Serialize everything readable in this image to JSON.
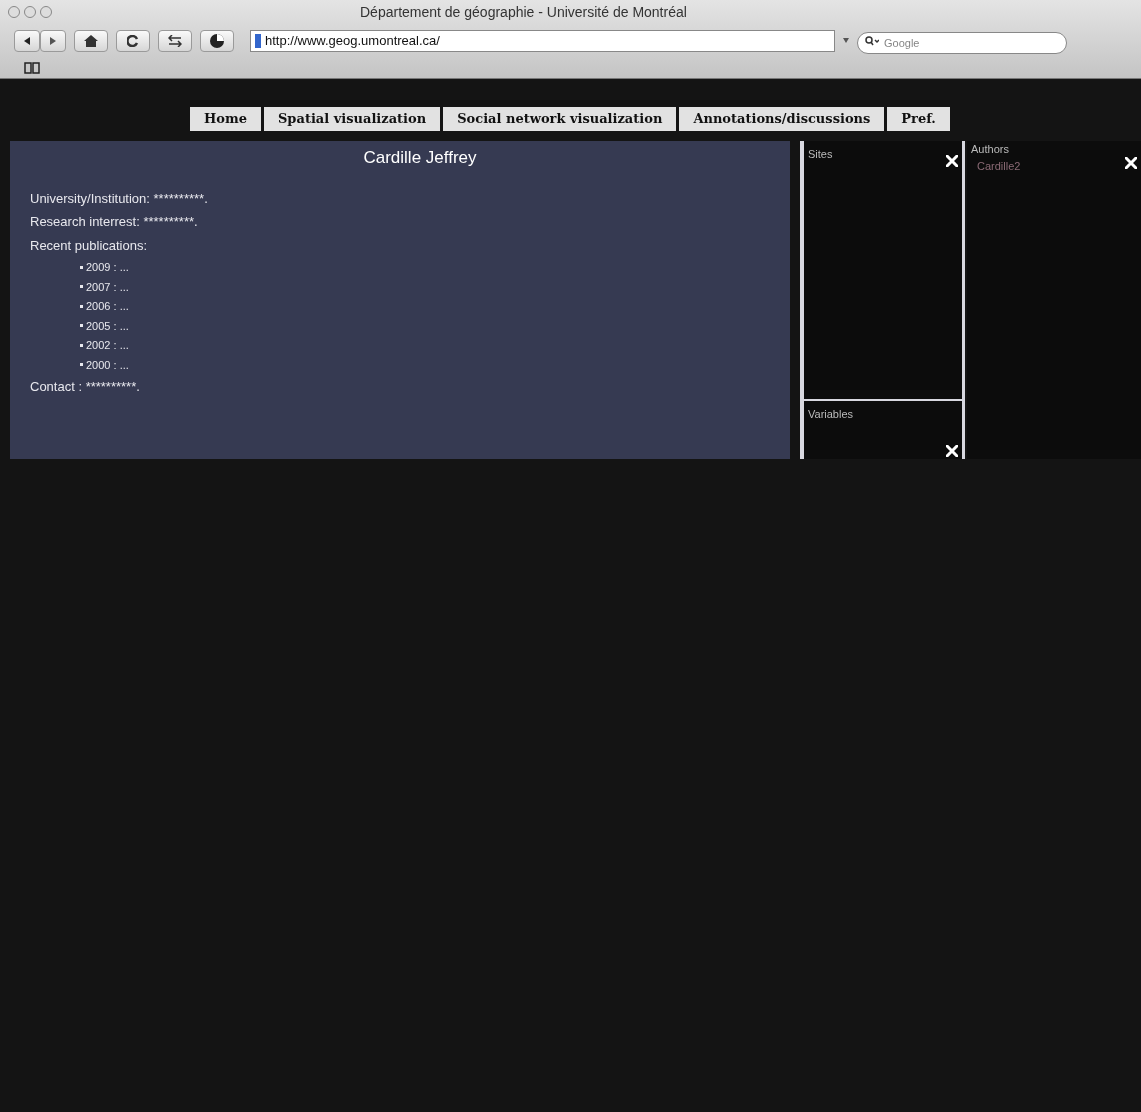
{
  "window": {
    "title": "Département de géographie - Université de Montréal"
  },
  "toolbar": {
    "url": "http://www.geog.umontreal.ca/",
    "search": {
      "placeholder": "Google"
    }
  },
  "nav": [
    "Home",
    "Spatial visualization",
    "Social network visualization",
    "Annotations/discussions",
    "Pref."
  ],
  "profile": {
    "name": "Cardille Jeffrey",
    "fields": [
      "University/Institution: **********.",
      "Research interrest: **********.",
      "Recent publications:"
    ],
    "publications": [
      "2009 : ...",
      "2007 : ...",
      "2006 : ...",
      "2005 : ...",
      "2002 : ...",
      "2000 : ..."
    ],
    "contact": "Contact : **********."
  },
  "sites": {
    "title": "Sites"
  },
  "variables": {
    "title": "Variables"
  },
  "authors": {
    "title": "Authors",
    "items": [
      "Cardille2"
    ]
  }
}
